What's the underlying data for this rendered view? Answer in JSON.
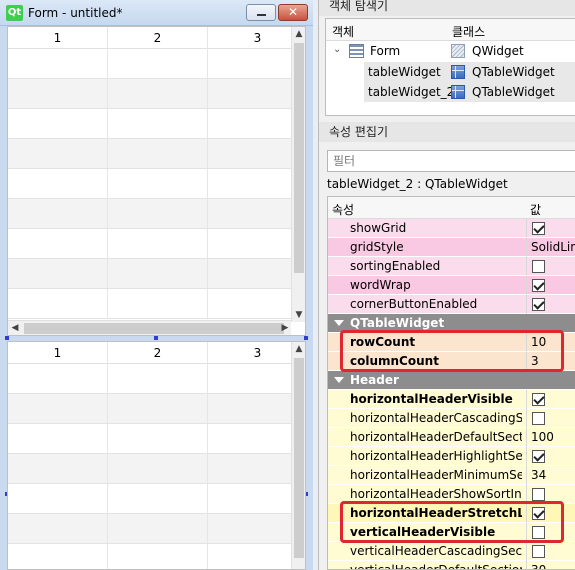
{
  "form_window": {
    "logo": "Qt",
    "title": "Form - untitled*",
    "close_glyph": "✕",
    "table1": {
      "columns": [
        "1",
        "2",
        "3"
      ]
    },
    "table2": {
      "columns": [
        "1",
        "2",
        "3"
      ]
    }
  },
  "object_inspector": {
    "title": "객체 탐색기",
    "col_object": "객체",
    "col_class": "클래스",
    "items": [
      {
        "name": "Form",
        "class": "QWidget",
        "icon": "widget-icon"
      },
      {
        "name": "tableWidget",
        "class": "QTableWidget",
        "icon": "table-icon"
      },
      {
        "name": "tableWidget_2",
        "class": "QTableWidget",
        "icon": "table-icon"
      }
    ]
  },
  "property_editor": {
    "title": "속성 편집기",
    "filter_placeholder": "필터",
    "selection": "tableWidget_2 : QTableWidget",
    "col_property": "속성",
    "col_value": "값",
    "rows": [
      {
        "name": "showGrid",
        "kind": "check",
        "checked": true,
        "tone": "pink",
        "bold": false
      },
      {
        "name": "gridStyle",
        "kind": "text",
        "value": "SolidLine",
        "tone": "pink2",
        "bold": false
      },
      {
        "name": "sortingEnabled",
        "kind": "check",
        "checked": false,
        "tone": "pink",
        "bold": false
      },
      {
        "name": "wordWrap",
        "kind": "check",
        "checked": true,
        "tone": "pink2",
        "bold": false
      },
      {
        "name": "cornerButtonEnabled",
        "kind": "check",
        "checked": true,
        "tone": "pink",
        "bold": false
      },
      {
        "name": "QTableWidget",
        "kind": "group"
      },
      {
        "name": "rowCount",
        "kind": "text",
        "value": "10",
        "tone": "peach",
        "bold": true
      },
      {
        "name": "columnCount",
        "kind": "text",
        "value": "3",
        "tone": "peach",
        "bold": true
      },
      {
        "name": "Header",
        "kind": "group"
      },
      {
        "name": "horizontalHeaderVisible",
        "kind": "check",
        "checked": true,
        "tone": "yellow",
        "bold": true
      },
      {
        "name": "horizontalHeaderCascadingSe...",
        "kind": "check",
        "checked": false,
        "tone": "yellow",
        "bold": false
      },
      {
        "name": "horizontalHeaderDefaultSectio...",
        "kind": "text",
        "value": "100",
        "tone": "yellow",
        "bold": false
      },
      {
        "name": "horizontalHeaderHighlightSec...",
        "kind": "check",
        "checked": true,
        "tone": "yellow",
        "bold": false
      },
      {
        "name": "horizontalHeaderMinimumSec...",
        "kind": "text",
        "value": "34",
        "tone": "yellow",
        "bold": false
      },
      {
        "name": "horizontalHeaderShowSortIndi...",
        "kind": "check",
        "checked": false,
        "tone": "yellow",
        "bold": false
      },
      {
        "name": "horizontalHeaderStretchLas...",
        "kind": "check",
        "checked": true,
        "tone": "yellow2",
        "bold": true
      },
      {
        "name": "verticalHeaderVisible",
        "kind": "check",
        "checked": false,
        "tone": "yellow",
        "bold": true
      },
      {
        "name": "verticalHeaderCascadingSectio...",
        "kind": "check",
        "checked": false,
        "tone": "yellow",
        "bold": false
      },
      {
        "name": "verticalHeaderDefaultSectionS...",
        "kind": "text",
        "value": "30",
        "tone": "yellow",
        "bold": false
      }
    ]
  },
  "colors": {
    "highlight_box": "#e0262e",
    "selection_handle": "#2f3ecd",
    "group_header": "#8d8d8d"
  }
}
